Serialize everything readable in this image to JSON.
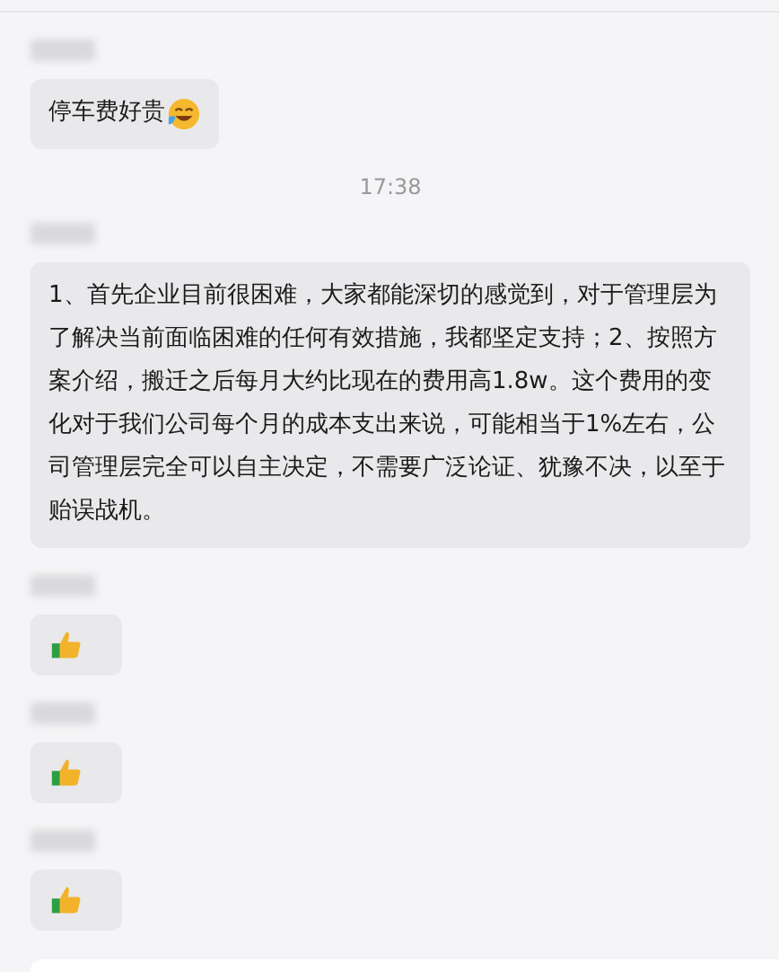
{
  "messages": [
    {
      "kind": "text",
      "text": "停车费好贵",
      "emoji": true
    },
    {
      "kind": "time",
      "text": "17:38"
    },
    {
      "kind": "text",
      "text": "1、首先企业目前很困难，大家都能深切的感觉到，对于管理层为了解决当前面临困难的任何有效措施，我都坚定支持；2、按照方案介绍，搬迁之后每月大约比现在的费用高1.8w。这个费用的变化对于我们公司每个月的成本支出来说，可能相当于1%左右，公司管理层完全可以自主决定，不需要广泛论证、犹豫不决，以至于贻误战机。",
      "emoji": false
    },
    {
      "kind": "sticker"
    },
    {
      "kind": "sticker"
    },
    {
      "kind": "sticker"
    }
  ]
}
